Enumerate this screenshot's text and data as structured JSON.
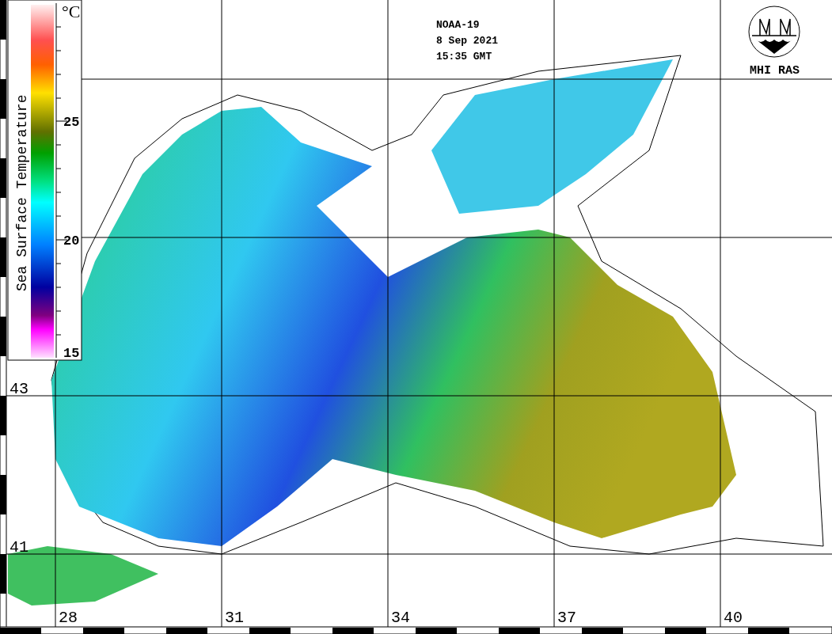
{
  "header": {
    "satellite": "NOAA-19",
    "date": "8 Sep 2021",
    "time": "15:35 GMT"
  },
  "logo": {
    "label": "MHI RAS"
  },
  "legend": {
    "title": "Sea Surface Temperature",
    "unit": "°C",
    "ticks": [
      "25",
      "20",
      "15"
    ]
  },
  "grid": {
    "longitudes": [
      "28",
      "31",
      "34",
      "37",
      "40"
    ],
    "latitudes": [
      "43",
      "41"
    ]
  }
}
